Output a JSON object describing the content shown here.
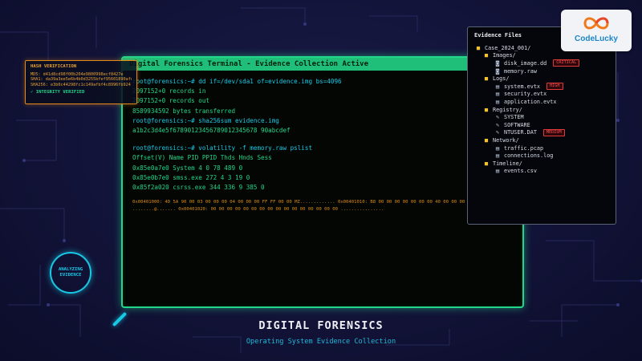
{
  "terminal": {
    "title": "Digital Forensics Terminal - Evidence Collection Active",
    "lines": [
      {
        "type": "prompt",
        "text": "root@forensics:~# dd if=/dev/sda1 of=evidence.img bs=4096"
      },
      {
        "type": "out",
        "text": "2097152+0 records in"
      },
      {
        "type": "out",
        "text": "2097152+0 records out"
      },
      {
        "type": "out",
        "text": "8589934592 bytes transferred"
      },
      {
        "type": "prompt",
        "text": "root@forensics:~# sha256sum evidence.img"
      },
      {
        "type": "out",
        "text": "a1b2c3d4e5f67890123456789012345678 90abcdef"
      },
      {
        "type": "gap",
        "text": ""
      },
      {
        "type": "prompt",
        "text": "root@forensics:~# volatility -f memory.raw pslist"
      },
      {
        "type": "out",
        "text": "Offset(V) Name PID PPID Thds Hnds Sess"
      },
      {
        "type": "out",
        "text": "0x85e0a7e0 System 4 0 78 489 0"
      },
      {
        "type": "out",
        "text": "0x85e0b7e0 smss.exe 272 4 3 19 0"
      },
      {
        "type": "out",
        "text": "0x85f2a020 csrss.exe 344 336 9 385 0"
      }
    ],
    "hex_dump": "0x00401000: 4D 5A 90 00 03 00 00 00 04 00 00 00 FF FF 00 00 MZ............. 0x00401010: B8 00 00 00 00 00 00 00 40 00 00 00 00 00 00 00 ........@....... 0x00401020: 00 00 00 00 00 00 00 00 00 00 00 00 00 00 00 00 ................"
  },
  "hash_panel": {
    "title": "HASH VERIFICATION",
    "md5": "MD5: d41d8cd98f00b204e9800998ecf8427e",
    "sha1": "SHA1: da39a3ee5e6b4b0d3255bfef95601890afd80709",
    "sha256": "SHA256: e3b0c44298fc1c149afbf4c8996fb924...",
    "status": "✓ INTEGRITY VERIFIED"
  },
  "evidence_files": {
    "title": "Evidence Files",
    "items": [
      {
        "level": 0,
        "icon": "folder-icon",
        "label": "Case_2024_001/",
        "badge": ""
      },
      {
        "level": 1,
        "icon": "folder-icon",
        "label": "Images/",
        "badge": ""
      },
      {
        "level": 2,
        "icon": "disk-icon",
        "label": "disk_image.dd",
        "badge": "CRITICAL"
      },
      {
        "level": 2,
        "icon": "disk-icon",
        "label": "memory.raw",
        "badge": ""
      },
      {
        "level": 1,
        "icon": "folder-icon",
        "label": "Logs/",
        "badge": ""
      },
      {
        "level": 2,
        "icon": "file-icon",
        "label": "system.evtx",
        "badge": "HIGH"
      },
      {
        "level": 2,
        "icon": "file-icon",
        "label": "security.evtx",
        "badge": ""
      },
      {
        "level": 2,
        "icon": "file-icon",
        "label": "application.evtx",
        "badge": ""
      },
      {
        "level": 1,
        "icon": "folder-icon",
        "label": "Registry/",
        "badge": ""
      },
      {
        "level": 2,
        "icon": "wrench-icon",
        "label": "SYSTEM",
        "badge": ""
      },
      {
        "level": 2,
        "icon": "wrench-icon",
        "label": "SOFTWARE",
        "badge": ""
      },
      {
        "level": 2,
        "icon": "wrench-icon",
        "label": "NTUSER.DAT",
        "badge": "MEDIUM"
      },
      {
        "level": 1,
        "icon": "folder-icon",
        "label": "Network/",
        "badge": ""
      },
      {
        "level": 2,
        "icon": "image-file-icon",
        "label": "traffic.pcap",
        "badge": ""
      },
      {
        "level": 2,
        "icon": "file-icon",
        "label": "connections.log",
        "badge": ""
      },
      {
        "level": 1,
        "icon": "folder-icon",
        "label": "Timeline/",
        "badge": ""
      },
      {
        "level": 2,
        "icon": "file-icon",
        "label": "events.csv",
        "badge": ""
      }
    ]
  },
  "logo": {
    "text": "CodeLucky"
  },
  "analyzing": {
    "line1": "ANALYZING",
    "line2": "EVIDENCE"
  },
  "footer": {
    "title": "DIGITAL FORENSICS",
    "subtitle": "Operating System Evidence Collection"
  },
  "colors": {
    "accent_green": "#22d68a",
    "accent_cyan": "#18c9e6",
    "accent_orange": "#e08a1c",
    "badge_red": "#e03a3a"
  }
}
